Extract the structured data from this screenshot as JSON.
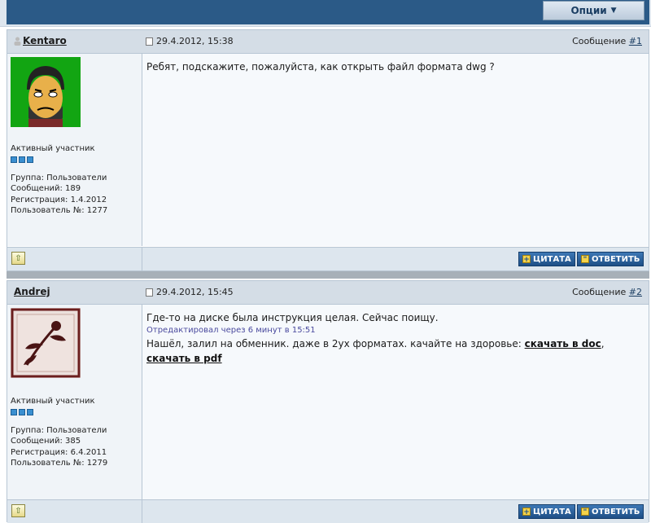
{
  "toolbar": {
    "options_label": "Опции"
  },
  "posts": [
    {
      "author": "Kentaro",
      "date": "29.4.2012, 15:38",
      "post_number_prefix": "Сообщение",
      "post_number": "#1",
      "rank": "Активный участник",
      "group": "Группа: Пользователи",
      "messages": "Сообщений: 189",
      "registered": "Регистрация: 1.4.2012",
      "user_id": "Пользователь №: 1277",
      "text": "Ребят, подскажите, пожалуйста, как открыть файл формата dwg ?"
    },
    {
      "author": "Andrej",
      "date": "29.4.2012, 15:45",
      "post_number_prefix": "Сообщение",
      "post_number": "#2",
      "rank": "Активный участник",
      "group": "Группа: Пользователи",
      "messages": "Сообщений: 385",
      "registered": "Регистрация: 6.4.2011",
      "user_id": "Пользователь №: 1279",
      "text_line1": "Где-то на диске была инструкция целая. Сейчас поищу.",
      "edited": "Отредактировал через 6 минут в 15:51",
      "text_line2": "Нашёл, залил на обменник. даже в 2ух форматах. качайте на здоровье:",
      "link_doc": "скачать в doc",
      "comma": ",",
      "link_pdf": "скачать в pdf"
    }
  ],
  "actions": {
    "quote_label": "ЦИТАТА",
    "reply_label": "ОТВЕТИТЬ"
  },
  "colors": {
    "header_blue": "#2b5a87",
    "button_blue": "#1e4f86",
    "row_header": "#d4dde6"
  }
}
